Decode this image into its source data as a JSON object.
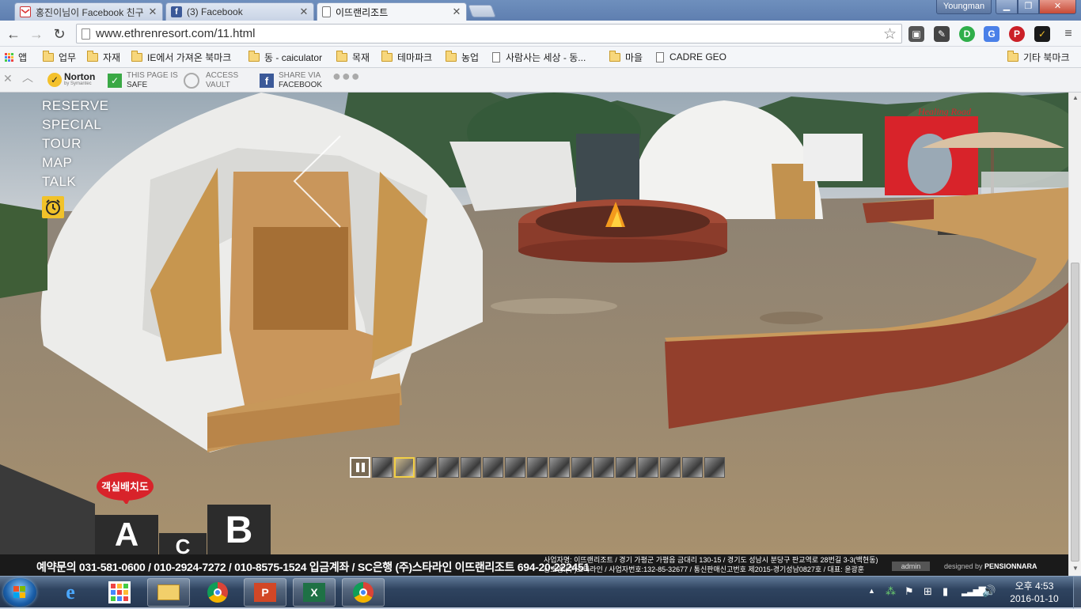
{
  "browser": {
    "tabs": [
      {
        "title": "홍진이님이 Facebook 친구",
        "favicon": "gmail-icon"
      },
      {
        "title": "(3) Facebook",
        "favicon": "facebook-icon"
      },
      {
        "title": "이뜨랜리조트",
        "favicon": "page-icon"
      }
    ],
    "user": "Youngman",
    "url": "www.ethrenresort.com/11.html",
    "bookmarks": [
      {
        "label": "앱",
        "kind": "apps"
      },
      {
        "label": "업무",
        "kind": "folder"
      },
      {
        "label": "자재",
        "kind": "folder"
      },
      {
        "label": "IE에서 가져온 북마크",
        "kind": "folder"
      },
      {
        "label": "동 - caiculator",
        "kind": "folder"
      },
      {
        "label": "목재",
        "kind": "folder"
      },
      {
        "label": "테마파크",
        "kind": "folder"
      },
      {
        "label": "농업",
        "kind": "folder"
      },
      {
        "label": "사람사는 세상 - 동...",
        "kind": "page"
      },
      {
        "label": "마을",
        "kind": "folder"
      },
      {
        "label": "CADRE GEO",
        "kind": "page"
      },
      {
        "label": "기타 북마크",
        "kind": "folder"
      }
    ]
  },
  "norton": {
    "brand": "Norton",
    "sub": "by Symantec",
    "safe_line1": "THIS PAGE IS",
    "safe_line2": "SAFE",
    "vault_line1": "ACCESS",
    "vault_line2": "VAULT",
    "share_line1": "SHARE VIA",
    "share_line2": "FACEBOOK"
  },
  "site": {
    "menu": [
      "RESERVE",
      "SPECIAL",
      "TOUR",
      "MAP",
      "TALK"
    ],
    "room_badge": "객실배치도",
    "rooms": {
      "a": "A",
      "c": "C",
      "b": "B"
    },
    "sign_text": "Healing Road",
    "thumbnail_count": 16,
    "selected_thumbnail": 2
  },
  "footer": {
    "contact": "예약문의 031-581-0600 / 010-2924-7272 / 010-8575-1524  입금계좌 / SC은행 (주)스타라인 이뜨랜리조트 694-20-222451",
    "biz_line1": "사업자명: 이뜨랜리조트 / 경기 가평군 가평읍 금대리 130-15 / 경기도 성남시 분당구 판교역로 28번길 3-3(백현동)",
    "biz_line2": "상호명:(주)스타라인 / 사업자번호:132-85-32677 / 통신판매신고번호 제2015-경기성남0827호 / 대표: 윤광훈",
    "admin": "admin",
    "designed_prefix": "designed by ",
    "designed_by": "PENSIONNARA"
  },
  "taskbar": {
    "time": "오후 4:53",
    "date": "2016-01-10"
  }
}
